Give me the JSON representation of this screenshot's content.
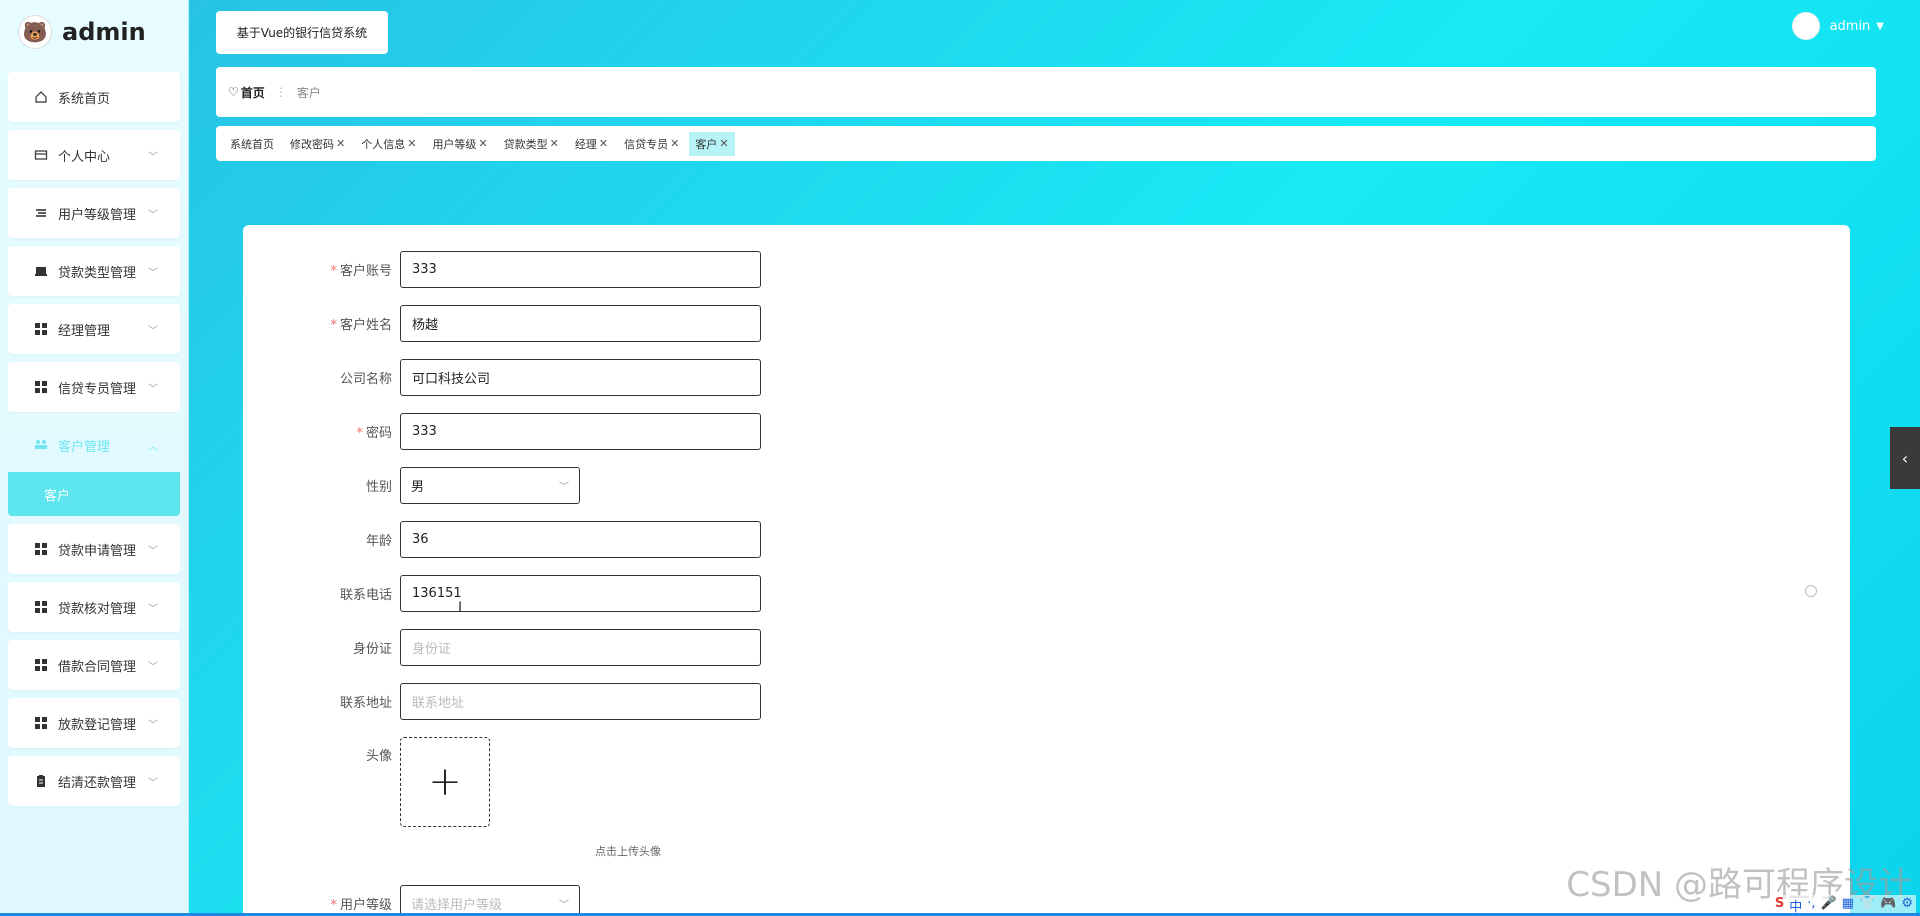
{
  "brand": {
    "name": "admin"
  },
  "sidebar": {
    "items": [
      {
        "label": "系统首页",
        "icon": "home-icon",
        "has_chevron": false
      },
      {
        "label": "个人中心",
        "icon": "card-icon",
        "has_chevron": true
      },
      {
        "label": "用户等级管理",
        "icon": "list-icon",
        "has_chevron": true
      },
      {
        "label": "贷款类型管理",
        "icon": "folder-icon",
        "has_chevron": true
      },
      {
        "label": "经理管理",
        "icon": "grid-icon",
        "has_chevron": true
      },
      {
        "label": "信贷专员管理",
        "icon": "grid-icon",
        "has_chevron": true
      },
      {
        "label": "客户管理",
        "icon": "users-icon",
        "has_chevron": true,
        "open": true
      },
      {
        "label": "贷款申请管理",
        "icon": "grid-icon",
        "has_chevron": true
      },
      {
        "label": "贷款核对管理",
        "icon": "grid-icon",
        "has_chevron": true
      },
      {
        "label": "借款合同管理",
        "icon": "grid-icon",
        "has_chevron": true
      },
      {
        "label": "放款登记管理",
        "icon": "grid-icon",
        "has_chevron": true
      },
      {
        "label": "结清还款管理",
        "icon": "clipboard-icon",
        "has_chevron": true
      }
    ],
    "submenu": {
      "label": "客户"
    }
  },
  "header": {
    "system_title": "基于Vue的银行信贷系统",
    "user_name": "admin"
  },
  "breadcrumb": {
    "home": "首页",
    "current": "客户"
  },
  "tags": [
    {
      "label": "系统首页",
      "closable": false
    },
    {
      "label": "修改密码",
      "closable": true
    },
    {
      "label": "个人信息",
      "closable": true
    },
    {
      "label": "用户等级",
      "closable": true
    },
    {
      "label": "贷款类型",
      "closable": true
    },
    {
      "label": "经理",
      "closable": true
    },
    {
      "label": "信贷专员",
      "closable": true
    },
    {
      "label": "客户",
      "closable": true,
      "active": true
    }
  ],
  "form": {
    "account": {
      "label": "客户账号",
      "value": "333",
      "required": true
    },
    "name": {
      "label": "客户姓名",
      "value": "杨越",
      "required": true
    },
    "company": {
      "label": "公司名称",
      "value": "可口科技公司",
      "required": false
    },
    "password": {
      "label": "密码",
      "value": "333",
      "required": true
    },
    "gender": {
      "label": "性别",
      "value": "男"
    },
    "age": {
      "label": "年龄",
      "value": "36"
    },
    "phone": {
      "label": "联系电话",
      "value": "136151"
    },
    "id_card": {
      "label": "身份证",
      "placeholder": "身份证"
    },
    "address": {
      "label": "联系地址",
      "placeholder": "联系地址"
    },
    "avatar": {
      "label": "头像",
      "hint": "点击上传头像",
      "plus": "+"
    },
    "level": {
      "label": "用户等级",
      "placeholder": "请选择用户等级",
      "required": true
    }
  },
  "watermark": "CSDN @路可程序设计",
  "tray": [
    "S",
    "中",
    "·,",
    "🎤",
    "▦",
    "👕",
    "🎮",
    "⚙"
  ],
  "colors": {
    "accent": "#18eaf5",
    "submenu_active": "#5ee6ee",
    "required": "#f56c6c"
  }
}
